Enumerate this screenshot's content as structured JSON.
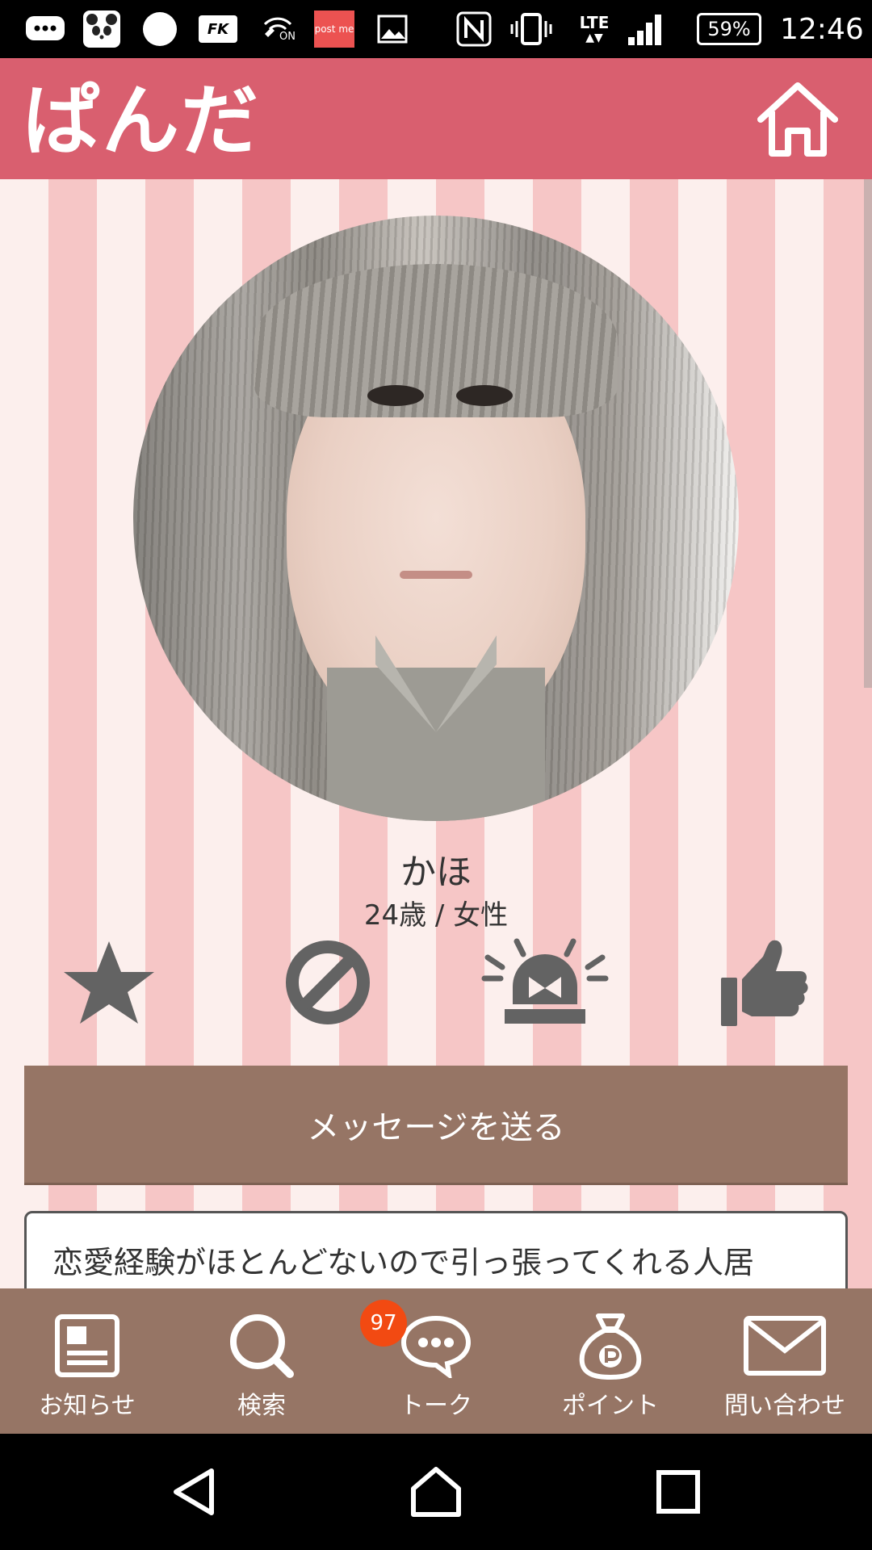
{
  "status_bar": {
    "post_me_label": "post me",
    "network": "LTE",
    "battery": "59%",
    "time": "12:46",
    "icons": [
      "message-icon",
      "panda-app-icon",
      "circle-icon",
      "fk-app-icon",
      "wifi-call-on-icon",
      "post-me-icon",
      "image-icon",
      "nfc-icon",
      "vibrate-icon",
      "lte-icon",
      "signal-icon",
      "battery-icon"
    ],
    "fk_label": "FK",
    "wifi_call_label": "ON"
  },
  "header": {
    "logo_text": "ぱんだ",
    "home_icon": "home-icon",
    "background": "#d95f6f"
  },
  "profile": {
    "name": "かほ",
    "meta": "24歳 / 女性",
    "actions": [
      {
        "icon": "star-icon"
      },
      {
        "icon": "block-icon"
      },
      {
        "icon": "report-alarm-icon"
      },
      {
        "icon": "thumbs-up-icon"
      }
    ],
    "message_button": "メッセージを送る",
    "intro_text": "恋愛経験がほとんどないので引っ張ってくれる人居"
  },
  "bottom_nav": {
    "items": [
      {
        "label": "お知らせ",
        "icon": "news-icon"
      },
      {
        "label": "検索",
        "icon": "search-icon"
      },
      {
        "label": "トーク",
        "icon": "chat-icon",
        "badge": "97"
      },
      {
        "label": "ポイント",
        "icon": "points-bag-icon"
      },
      {
        "label": "問い合わせ",
        "icon": "mail-icon"
      }
    ],
    "background": "#967565"
  },
  "system_nav": {
    "icons": [
      "back-icon",
      "home-nav-icon",
      "recents-icon"
    ]
  },
  "colors": {
    "stripe_light": "#fcefed",
    "stripe_pink": "#f6c6c6",
    "icon_gray": "#636363",
    "badge": "#f24a12"
  }
}
